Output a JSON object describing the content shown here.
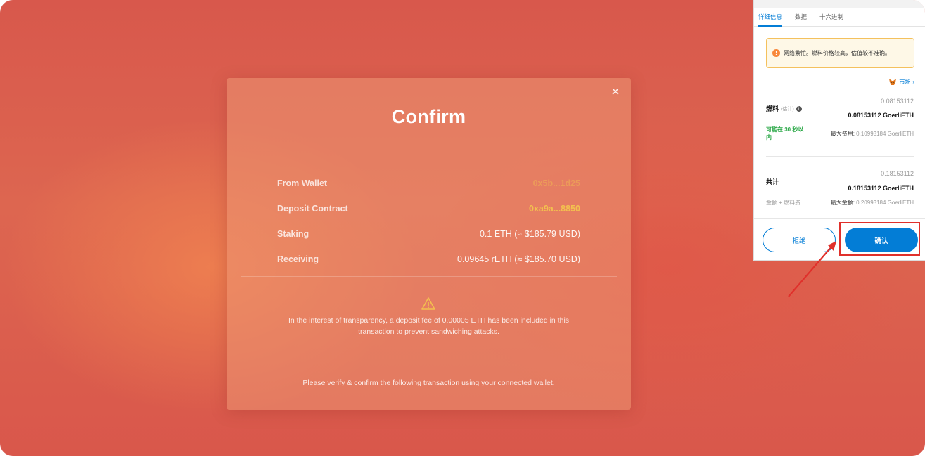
{
  "modal": {
    "title": "Confirm",
    "close_icon": "close-icon",
    "rows": [
      {
        "label": "From Wallet",
        "value": "0x5b...1d25",
        "style": "gold-faded"
      },
      {
        "label": "Deposit Contract",
        "value": "0xa9a...8850",
        "style": "gold"
      },
      {
        "label": "Staking",
        "value": "0.1 ETH (≈ $185.79 USD)",
        "style": "plain"
      },
      {
        "label": "Receiving",
        "value": "0.09645 rETH (≈ $185.70 USD)",
        "style": "plain"
      }
    ],
    "warning_icon": "warning-triangle-icon",
    "notice": "In the interest of transparency, a deposit fee of 0.00005 ETH has been included in this transaction to prevent sandwiching attacks.",
    "footer": "Please verify & confirm the following transaction using your connected wallet."
  },
  "wallet_popup": {
    "tabs": [
      "详细信息",
      "数据",
      "十六进制"
    ],
    "alert": "网络繁忙。燃料价格较高，估值较不准确。",
    "market_label": "市场",
    "gas": {
      "label": "燃料",
      "label_suffix": "(估计)",
      "estimate_small": "0.08153112",
      "estimate": "0.08153112 GoerliETH",
      "time_note": "可能在 30 秒以内",
      "max_fee_label": "最大费用:",
      "max_fee_value": "0.10993184 GoerliETH"
    },
    "total": {
      "label": "共计",
      "small": "0.18153112",
      "value": "0.18153112 GoerliETH",
      "sub_label": "金额 + 燃料费",
      "max_amount_label": "最大金额:",
      "max_amount_value": "0.20993184 GoerliETH"
    },
    "reject_label": "拒绝",
    "confirm_label": "确认",
    "colors": {
      "primary": "#037dd6",
      "alert_border": "#f4c15d",
      "highlight": "#e0302b"
    }
  }
}
